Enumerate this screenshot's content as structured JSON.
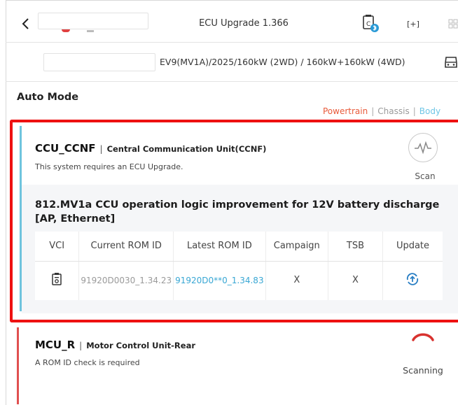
{
  "header": {
    "back_icon": "chevron-left-icon",
    "title": "ECU Upgrade 1.366",
    "vci_icon": "vci-bluetooth-icon",
    "scan_frame_label": "[+]",
    "grid_icon": "grid-icon"
  },
  "vehicle": {
    "spec": "EV9(MV1A)/2025/160kW (2WD) / 160kW+160kW (4WD)",
    "car_icon": "car-icon"
  },
  "mode": {
    "title": "Auto Mode",
    "categories": [
      "Powertrain",
      "Chassis",
      "Body"
    ],
    "separator": "|"
  },
  "ecus": [
    {
      "code": "CCU_CCNF",
      "separator": "|",
      "description": "Central Communication Unit(CCNF)",
      "status": "This system requires an ECU Upgrade.",
      "action_label": "Scan",
      "accent_color": "#6fc4de",
      "upgrade": {
        "title": "812.MV1a CCU operation logic improvement for 12V battery discharge [AP, Ethernet]",
        "columns": [
          "VCI",
          "Current ROM ID",
          "Latest ROM ID",
          "Campaign",
          "TSB",
          "Update"
        ],
        "row": {
          "vci_icon": "vci-device-icon",
          "current_rom": "91920D0030_1.34.23",
          "latest_rom": "91920D0**0_1.34.83",
          "campaign": "X",
          "tsb": "X",
          "update_icon": "upload-circle-icon"
        }
      }
    },
    {
      "code": "MCU_R",
      "separator": "|",
      "description": "Motor Control Unit-Rear",
      "status": "A ROM ID check is required",
      "action_label": "Scanning",
      "accent_color": "#e05050"
    }
  ],
  "colors": {
    "highlight_outline": "#ee1111",
    "powertrain": "#e85a3a",
    "chassis": "#9a9a9a",
    "body": "#6ec6e6",
    "latest_rom": "#39a7d4"
  }
}
